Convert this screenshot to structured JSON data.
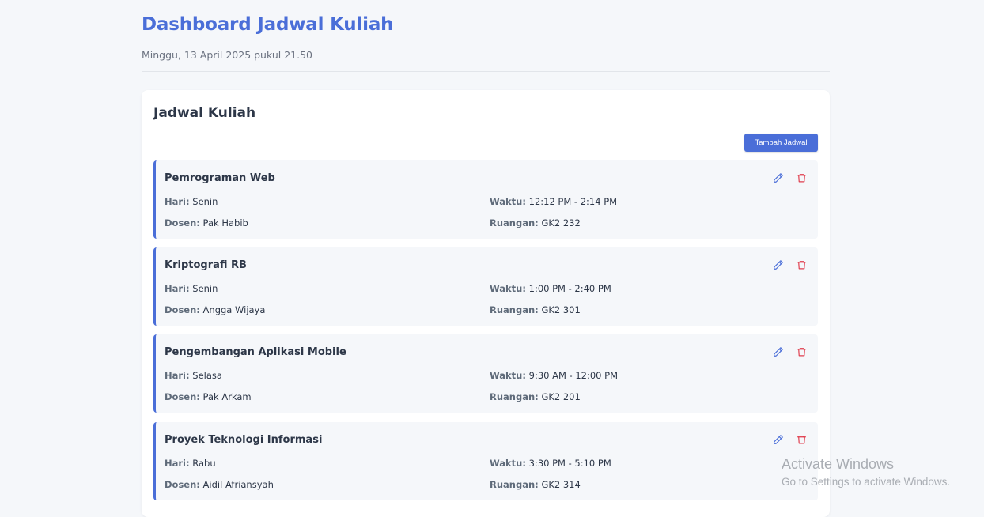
{
  "header": {
    "title": "Dashboard Jadwal Kuliah",
    "datetime": "Minggu, 13 April 2025 pukul 21.50"
  },
  "schedule": {
    "title": "Jadwal Kuliah",
    "add_label": "Tambah Jadwal",
    "labels": {
      "day": "Hari:",
      "lecturer": "Dosen:",
      "time": "Waktu:",
      "room": "Ruangan:"
    },
    "items": [
      {
        "course": "Pemrograman Web",
        "day": "Senin",
        "lecturer": "Pak Habib",
        "time": "12:12 PM - 2:14 PM",
        "room": "GK2 232"
      },
      {
        "course": "Kriptografi RB",
        "day": "Senin",
        "lecturer": "Angga Wijaya",
        "time": "1:00 PM - 2:40 PM",
        "room": "GK2 301"
      },
      {
        "course": "Pengembangan Aplikasi Mobile",
        "day": "Selasa",
        "lecturer": "Pak Arkam",
        "time": "9:30 AM - 12:00 PM",
        "room": "GK2 201"
      },
      {
        "course": "Proyek Teknologi Informasi",
        "day": "Rabu",
        "lecturer": "Aidil Afriansyah",
        "time": "3:30 PM - 5:10 PM",
        "room": "GK2 314"
      }
    ]
  },
  "overlay": {
    "activate_title": "Activate Windows",
    "activate_sub": "Go to Settings to activate Windows."
  },
  "colors": {
    "accent": "#4a6ed8",
    "danger": "#e03e4e",
    "background": "#f5f7fa"
  },
  "icons": {
    "edit": "pencil-icon",
    "delete": "trash-icon"
  }
}
